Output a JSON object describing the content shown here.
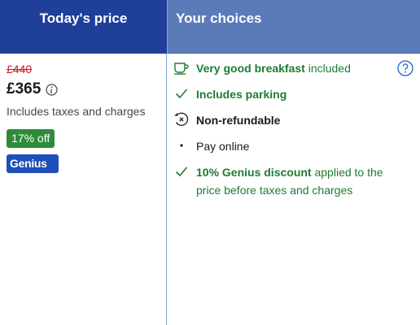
{
  "header": {
    "price_title": "Today's price",
    "choices_title": "Your choices"
  },
  "price": {
    "old_price": "£440",
    "current_price": "£365",
    "taxes_note": "Includes taxes and charges",
    "discount_badge": "17% off",
    "genius_badge": "Genius"
  },
  "choices": {
    "breakfast_bold": "Very good breakfast",
    "breakfast_rest": " included",
    "parking": "Includes parking",
    "refund": "Non-refundable",
    "payment": "Pay online",
    "genius_bold": "10% Genius discount",
    "genius_rest": " applied to the price before taxes and charges"
  },
  "colors": {
    "header_price_bg": "#1f3f99",
    "header_choices_bg": "#5a7bb8",
    "green": "#1e7c32",
    "strike_red": "#d4111e",
    "genius_blue": "#1f4fb8"
  },
  "icons": [
    "info-icon",
    "help-icon",
    "coffee-cup-icon",
    "checkmark-icon",
    "non-refundable-icon",
    "bullet-icon"
  ]
}
